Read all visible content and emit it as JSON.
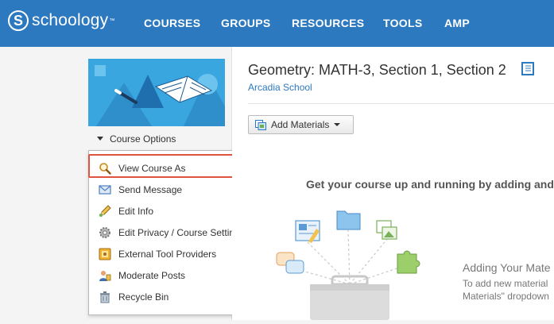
{
  "nav": {
    "logo_text": "schoology",
    "items": [
      "COURSES",
      "GROUPS",
      "RESOURCES",
      "TOOLS",
      "AMP"
    ]
  },
  "sidebar": {
    "course_options_label": "Course Options",
    "menu": [
      {
        "label": "View Course As",
        "icon": "magnifier-icon"
      },
      {
        "label": "Send Message",
        "icon": "envelope-icon"
      },
      {
        "label": "Edit Info",
        "icon": "pencil-icon"
      },
      {
        "label": "Edit Privacy / Course Settings",
        "icon": "gear-icon"
      },
      {
        "label": "External Tool Providers",
        "icon": "puzzle-icon"
      },
      {
        "label": "Moderate Posts",
        "icon": "user-icon"
      },
      {
        "label": "Recycle Bin",
        "icon": "trash-icon"
      }
    ]
  },
  "main": {
    "title": "Geometry: MATH-3, Section 1, Section 2",
    "school": "Arcadia School",
    "add_materials_label": "Add Materials",
    "empty_heading": "Get your course up and running by adding and",
    "adding_title": "Adding Your Mate",
    "adding_desc_line1": "To add new material",
    "adding_desc_line2": "Materials\" dropdown"
  },
  "colors": {
    "brand_blue": "#2d79c0",
    "highlight_red": "#e0533f"
  }
}
